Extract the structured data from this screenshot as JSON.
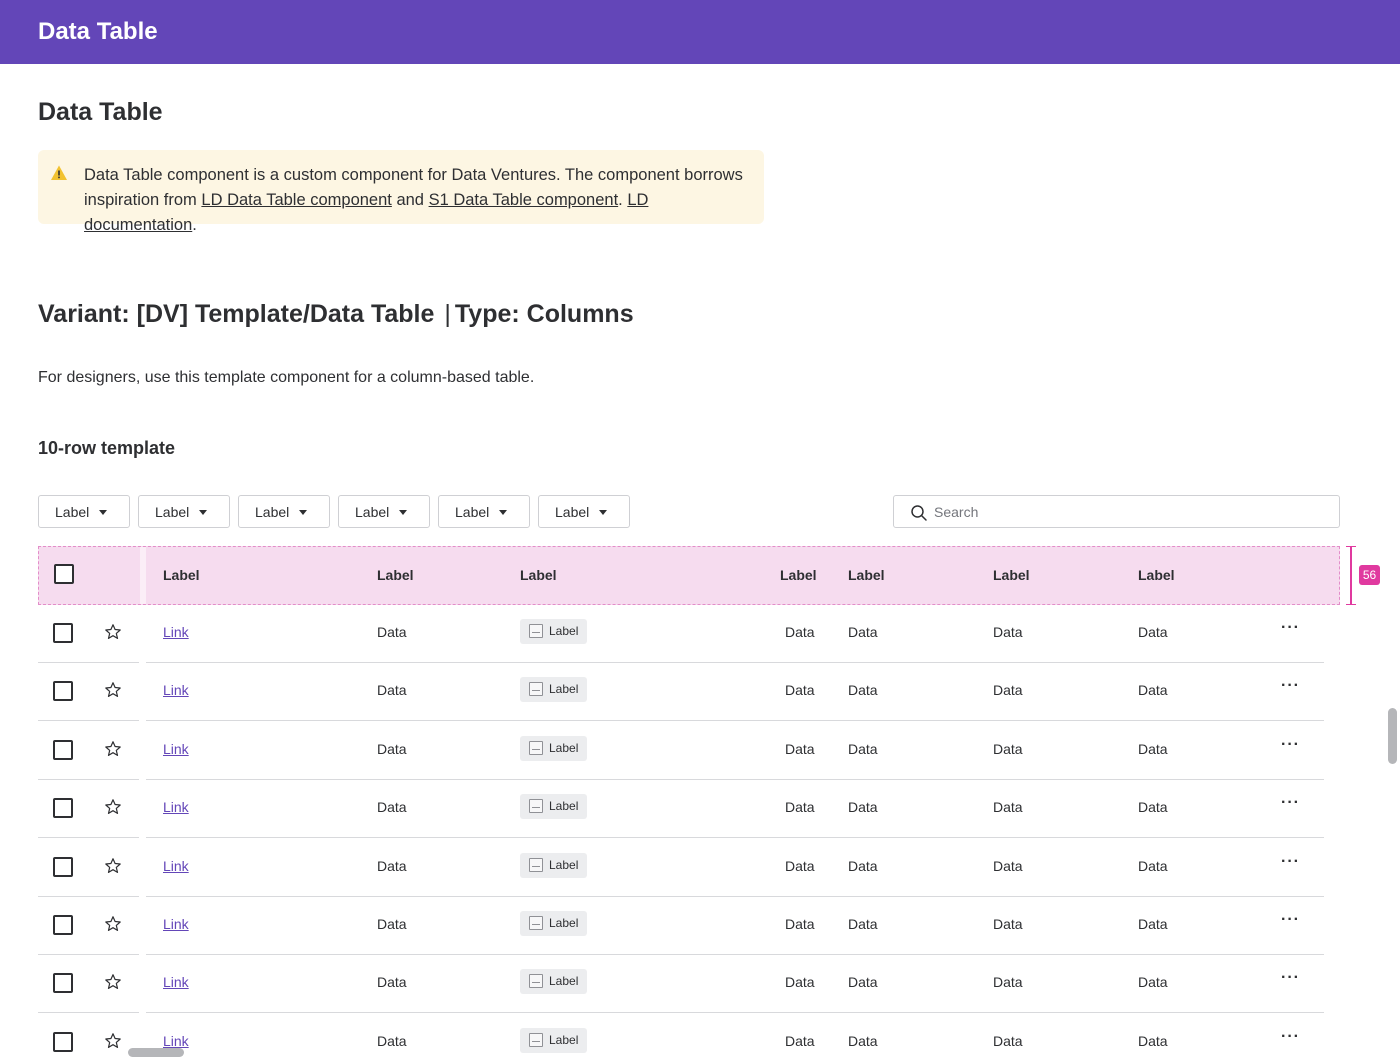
{
  "topbar": {
    "title": "Data Table"
  },
  "page": {
    "title": "Data Table"
  },
  "alert": {
    "text_1": "Data Table component is a custom component for Data Ventures. The component borrows inspiration from ",
    "link_ld": "LD Data Table component",
    "text_2": " and ",
    "link_s1": "S1 Data Table component",
    "text_3": ". ",
    "link_doc": "LD documentation",
    "text_4": "."
  },
  "variant": {
    "left": "Variant: [DV] Template/Data Table",
    "separator": "|",
    "right": "Type: Columns"
  },
  "description": "For designers, use this template component for a column-based table.",
  "subheading": "10-row template",
  "filters": [
    "Label",
    "Label",
    "Label",
    "Label",
    "Label",
    "Label"
  ],
  "search": {
    "placeholder": "Search",
    "value": ""
  },
  "table": {
    "headers": [
      "Label",
      "Label",
      "Label",
      "Label",
      "Label",
      "Label",
      "Label"
    ],
    "rows": [
      {
        "link": "Link",
        "c2": "Data",
        "tag": "Label",
        "c4": "Data",
        "c5": "Data",
        "c6": "Data",
        "c7": "Data",
        "more": "···"
      },
      {
        "link": "Link",
        "c2": "Data",
        "tag": "Label",
        "c4": "Data",
        "c5": "Data",
        "c6": "Data",
        "c7": "Data",
        "more": "···"
      },
      {
        "link": "Link",
        "c2": "Data",
        "tag": "Label",
        "c4": "Data",
        "c5": "Data",
        "c6": "Data",
        "c7": "Data",
        "more": "···"
      },
      {
        "link": "Link",
        "c2": "Data",
        "tag": "Label",
        "c4": "Data",
        "c5": "Data",
        "c6": "Data",
        "c7": "Data",
        "more": "···"
      },
      {
        "link": "Link",
        "c2": "Data",
        "tag": "Label",
        "c4": "Data",
        "c5": "Data",
        "c6": "Data",
        "c7": "Data",
        "more": "···"
      },
      {
        "link": "Link",
        "c2": "Data",
        "tag": "Label",
        "c4": "Data",
        "c5": "Data",
        "c6": "Data",
        "c7": "Data",
        "more": "···"
      },
      {
        "link": "Link",
        "c2": "Data",
        "tag": "Label",
        "c4": "Data",
        "c5": "Data",
        "c6": "Data",
        "c7": "Data",
        "more": "···"
      },
      {
        "link": "Link",
        "c2": "Data",
        "tag": "Label",
        "c4": "Data",
        "c5": "Data",
        "c6": "Data",
        "c7": "Data",
        "more": "···"
      }
    ]
  },
  "measurement": {
    "height_label": "56"
  },
  "icons": {
    "warning": "warning-icon",
    "search": "search-icon",
    "star": "star-icon",
    "more": "more-horizontal-icon",
    "image": "image-placeholder-icon"
  },
  "colors": {
    "brand": "#6346b8",
    "alert_bg": "#fdf6e3",
    "header_highlight": "#f6dcef",
    "measure": "#e0399f"
  }
}
